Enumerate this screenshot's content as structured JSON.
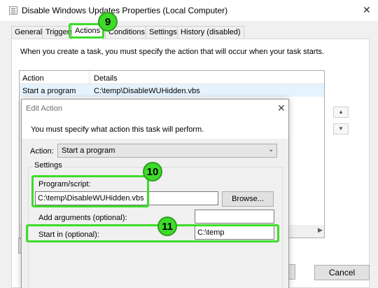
{
  "window": {
    "title": "Disable Windows Updates Properties (Local Computer)",
    "close_glyph": "✕"
  },
  "tabs": [
    {
      "label": "General"
    },
    {
      "label": "Triggers"
    },
    {
      "label": "Actions"
    },
    {
      "label": "Conditions"
    },
    {
      "label": "Settings"
    },
    {
      "label": "History (disabled)"
    }
  ],
  "actions_tab": {
    "intro": "When you create a task, you must specify the action that will occur when your task starts.",
    "columns": [
      "Action",
      "Details"
    ],
    "rows": [
      {
        "action": "Start a program",
        "details": "C:\\temp\\DisableWUHidden.vbs"
      }
    ],
    "move_up_glyph": "▲",
    "move_down_glyph": "▼",
    "scroll_right_glyph": "▶"
  },
  "footer": {
    "cancel_label": "Cancel"
  },
  "edit_action": {
    "title": "Edit Action",
    "close_glyph": "✕",
    "intro": "You must specify what action this task will perform.",
    "action_label": "Action:",
    "action_value": "Start a program",
    "settings_label": "Settings",
    "program_label": "Program/script:",
    "program_value": "C:\\temp\\DisableWUHidden.vbs",
    "browse_label": "Browse...",
    "args_label": "Add arguments (optional):",
    "args_value": "",
    "startin_label": "Start in (optional):",
    "startin_value": "C:\\temp"
  },
  "annotations": {
    "badge_actions": "9",
    "badge_program": "10",
    "badge_startin": "11",
    "highlight_color": "#3ddc2a"
  },
  "icons": {
    "title_icon": "task-scheduler-icon",
    "dropdown": "chevron-down-icon"
  }
}
